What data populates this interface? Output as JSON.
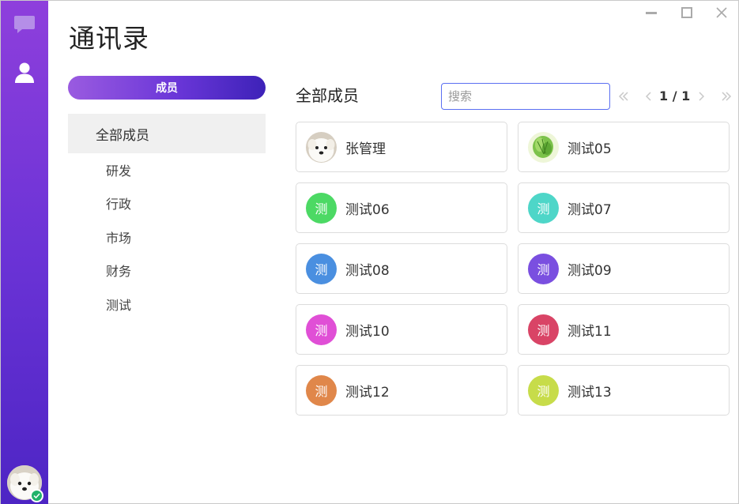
{
  "page_title": "通讯录",
  "group_tab": "成员",
  "groups": {
    "all": "全部成员",
    "items": [
      "研发",
      "行政",
      "市场",
      "财务",
      "测试"
    ]
  },
  "members_title": "全部成员",
  "search": {
    "placeholder": "搜索",
    "value": ""
  },
  "pagination": {
    "text": "1 / 1"
  },
  "members": [
    {
      "name": "张管理",
      "avatar_text": "",
      "avatar_color": "#efe9df",
      "avatar_type": "dog-photo"
    },
    {
      "name": "测试05",
      "avatar_text": "",
      "avatar_color": "#eef6d8",
      "avatar_type": "cabbage-image"
    },
    {
      "name": "测试06",
      "avatar_text": "测",
      "avatar_color": "#4cd964"
    },
    {
      "name": "测试07",
      "avatar_text": "测",
      "avatar_color": "#4ed6c8"
    },
    {
      "name": "测试08",
      "avatar_text": "测",
      "avatar_color": "#4a8fe0"
    },
    {
      "name": "测试09",
      "avatar_text": "测",
      "avatar_color": "#7a4fe0"
    },
    {
      "name": "测试10",
      "avatar_text": "测",
      "avatar_color": "#e04fd6"
    },
    {
      "name": "测试11",
      "avatar_text": "测",
      "avatar_color": "#d94466"
    },
    {
      "name": "测试12",
      "avatar_text": "测",
      "avatar_color": "#e0874a"
    },
    {
      "name": "测试13",
      "avatar_text": "测",
      "avatar_color": "#c7dc4a"
    }
  ],
  "colors": {
    "rail_top": "#8e3fdc",
    "rail_bottom": "#4d25c4",
    "accent": "#6a36d8",
    "search_border": "#5b6ff2",
    "online": "#1fb26b"
  },
  "icons": {
    "rail_chat": "chat-bubble-icon",
    "rail_contacts": "user-icon",
    "pager_first": "double-chevron-left-icon",
    "pager_prev": "chevron-left-icon",
    "pager_next": "chevron-right-icon",
    "pager_last": "double-chevron-right-icon"
  }
}
